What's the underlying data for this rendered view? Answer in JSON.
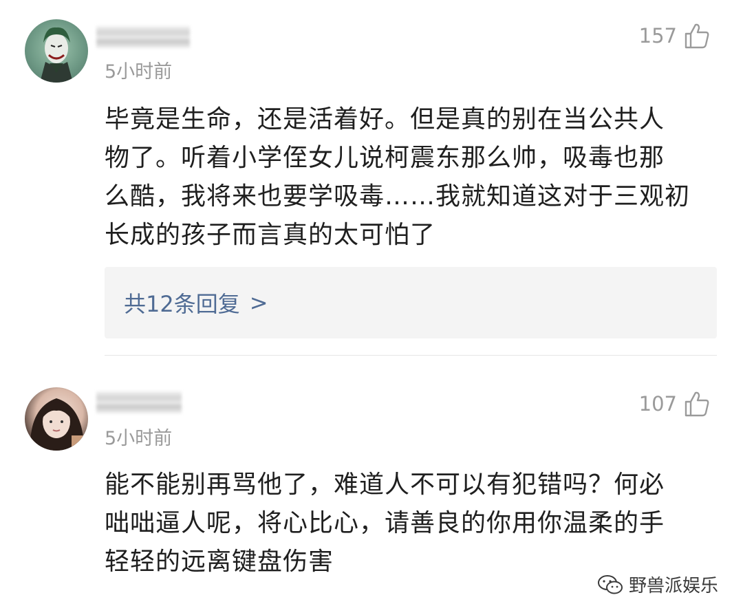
{
  "comments": [
    {
      "avatar_icon": "joker-avatar",
      "time": "5小时前",
      "likes": "157",
      "lines": [
        "毕竟是生命，还是活着好。但是真的别在当公共人",
        "物了。听着小学侄女儿说柯震东那么帅，吸毒也那",
        "么酷，我将来也要学吸毒……我就知道这对于三观初",
        "长成的孩子而言真的太可怕了"
      ],
      "reply_label": "共12条回复",
      "reply_arrow": ">"
    },
    {
      "avatar_icon": "girl-avatar",
      "time": "5小时前",
      "likes": "107",
      "lines": [
        "能不能别再骂他了，难道人不可以有犯错吗？何必",
        "咄咄逼人呢，将心比心，请善良的你用你温柔的手",
        "轻轻的远离键盘伤害"
      ]
    }
  ],
  "watermark": {
    "icon": "wechat-icon",
    "text": "野兽派娱乐"
  },
  "colors": {
    "link": "#4f6b94",
    "meta": "#9a9a9a",
    "reply_bg": "#f4f4f4"
  }
}
